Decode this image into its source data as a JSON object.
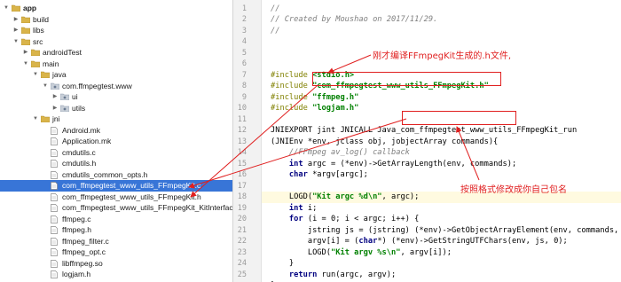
{
  "tree": [
    {
      "label": "app",
      "type": "folder",
      "depth": 0,
      "open": true,
      "bold": true
    },
    {
      "label": "build",
      "type": "folder",
      "depth": 1,
      "open": false
    },
    {
      "label": "libs",
      "type": "folder",
      "depth": 1,
      "open": false
    },
    {
      "label": "src",
      "type": "folder",
      "depth": 1,
      "open": true
    },
    {
      "label": "androidTest",
      "type": "folder",
      "depth": 2,
      "open": false
    },
    {
      "label": "main",
      "type": "folder",
      "depth": 2,
      "open": true
    },
    {
      "label": "java",
      "type": "folder",
      "depth": 3,
      "open": true
    },
    {
      "label": "com.ffmpegtest.www",
      "type": "package",
      "depth": 4,
      "open": true
    },
    {
      "label": "ui",
      "type": "package",
      "depth": 5,
      "open": false
    },
    {
      "label": "utils",
      "type": "package",
      "depth": 5,
      "open": false
    },
    {
      "label": "jni",
      "type": "folder",
      "depth": 3,
      "open": true
    },
    {
      "label": "Android.mk",
      "type": "file",
      "depth": 4
    },
    {
      "label": "Application.mk",
      "type": "file",
      "depth": 4
    },
    {
      "label": "cmdutils.c",
      "type": "file",
      "depth": 4
    },
    {
      "label": "cmdutils.h",
      "type": "file",
      "depth": 4
    },
    {
      "label": "cmdutils_common_opts.h",
      "type": "file",
      "depth": 4
    },
    {
      "label": "com_ffmpegtest_www_utils_FFmpegKit.c",
      "type": "file",
      "depth": 4,
      "selected": true
    },
    {
      "label": "com_ffmpegtest_www_utils_FFmpegKit.h",
      "type": "file",
      "depth": 4
    },
    {
      "label": "com_ffmpegtest_www_utils_FFmpegKit_KitInterface.h",
      "type": "file",
      "depth": 4
    },
    {
      "label": "ffmpeg.c",
      "type": "file",
      "depth": 4
    },
    {
      "label": "ffmpeg.h",
      "type": "file",
      "depth": 4
    },
    {
      "label": "ffmpeg_filter.c",
      "type": "file",
      "depth": 4
    },
    {
      "label": "ffmpeg_opt.c",
      "type": "file",
      "depth": 4
    },
    {
      "label": "libffmpeg.so",
      "type": "file",
      "depth": 4
    },
    {
      "label": "logjam.h",
      "type": "file",
      "depth": 4
    }
  ],
  "editor": {
    "line_numbers": [
      "1",
      "2",
      "3",
      "4",
      "5",
      "6",
      "7",
      "8",
      "9",
      "10",
      "11",
      "12",
      "13",
      "14",
      "15",
      "16",
      "17",
      "18",
      "19",
      "20",
      "21",
      "22",
      "23",
      "24",
      "25"
    ],
    "lines": [
      [
        {
          "t": "//",
          "c": "cm"
        }
      ],
      [
        {
          "t": "// Created by Moushao on 2017/11/29.",
          "c": "cm"
        }
      ],
      [
        {
          "t": "//",
          "c": "cm"
        }
      ],
      [
        {
          "t": "",
          "c": ""
        }
      ],
      [
        {
          "t": "",
          "c": ""
        }
      ],
      [
        {
          "t": "",
          "c": ""
        }
      ],
      [
        {
          "t": "#include ",
          "c": "mc"
        },
        {
          "t": "<stdio.h>",
          "c": "st"
        }
      ],
      [
        {
          "t": "#include ",
          "c": "mc"
        },
        {
          "t": "\"com_ffmpegtest_www_utils_FFmpegKit.h\"",
          "c": "st"
        }
      ],
      [
        {
          "t": "#include ",
          "c": "mc"
        },
        {
          "t": "\"ffmpeg.h\"",
          "c": "st"
        }
      ],
      [
        {
          "t": "#include ",
          "c": "mc"
        },
        {
          "t": "\"logjam.h\"",
          "c": "st"
        }
      ],
      [
        {
          "t": "",
          "c": ""
        }
      ],
      [
        {
          "t": "JNIEXPORT jint JNICALL Java_com_ffmpegtest_www_utils_FFmpegKit_run",
          "c": ""
        }
      ],
      [
        {
          "t": "(JNIEnv *env, jclass obj, jobjectArray commands){",
          "c": ""
        }
      ],
      [
        {
          "t": "    //FFmpeg av_log() callback",
          "c": "cm"
        }
      ],
      [
        {
          "t": "    ",
          "c": ""
        },
        {
          "t": "int",
          "c": "kw"
        },
        {
          "t": " argc = (*env)->GetArrayLength(env, commands);",
          "c": ""
        }
      ],
      [
        {
          "t": "    ",
          "c": ""
        },
        {
          "t": "char",
          "c": "kw"
        },
        {
          "t": " *argv[argc];",
          "c": ""
        }
      ],
      [
        {
          "t": "",
          "c": ""
        }
      ],
      [
        {
          "t": "    LOGD(",
          "c": ""
        },
        {
          "t": "\"Kit argc %d\\n\"",
          "c": "st"
        },
        {
          "t": ", argc);",
          "c": ""
        }
      ],
      [
        {
          "t": "    ",
          "c": ""
        },
        {
          "t": "int",
          "c": "kw"
        },
        {
          "t": " i;",
          "c": ""
        }
      ],
      [
        {
          "t": "    ",
          "c": ""
        },
        {
          "t": "for",
          "c": "kw"
        },
        {
          "t": " (i = 0; i < argc; i++) {",
          "c": ""
        }
      ],
      [
        {
          "t": "        jstring js = (jstring) (*env)->GetObjectArrayElement(env, commands, i);",
          "c": ""
        }
      ],
      [
        {
          "t": "        argv[i] = (",
          "c": ""
        },
        {
          "t": "char",
          "c": "kw"
        },
        {
          "t": "*) (*env)->GetStringUTFChars(env, js, 0);",
          "c": ""
        }
      ],
      [
        {
          "t": "        LOGD(",
          "c": ""
        },
        {
          "t": "\"Kit argv %s\\n\"",
          "c": "st"
        },
        {
          "t": ", argv[i]);",
          "c": ""
        }
      ],
      [
        {
          "t": "    }",
          "c": ""
        }
      ],
      [
        {
          "t": "    ",
          "c": ""
        },
        {
          "t": "return",
          "c": "kw"
        },
        {
          "t": " run(argc, argv);",
          "c": ""
        }
      ],
      [
        {
          "t": "}",
          "c": ""
        }
      ]
    ]
  },
  "annotations": {
    "note_header": "刚才编译FFmpegKit生成的.h文件,",
    "note_package": "按照格式修改成你自己包名",
    "color": "#e02020"
  },
  "colors": {
    "selection": "#3875d7",
    "current_line": "#fffae0",
    "keyword": "#000080",
    "comment": "#808080",
    "string": "#008000",
    "macro": "#808000"
  }
}
